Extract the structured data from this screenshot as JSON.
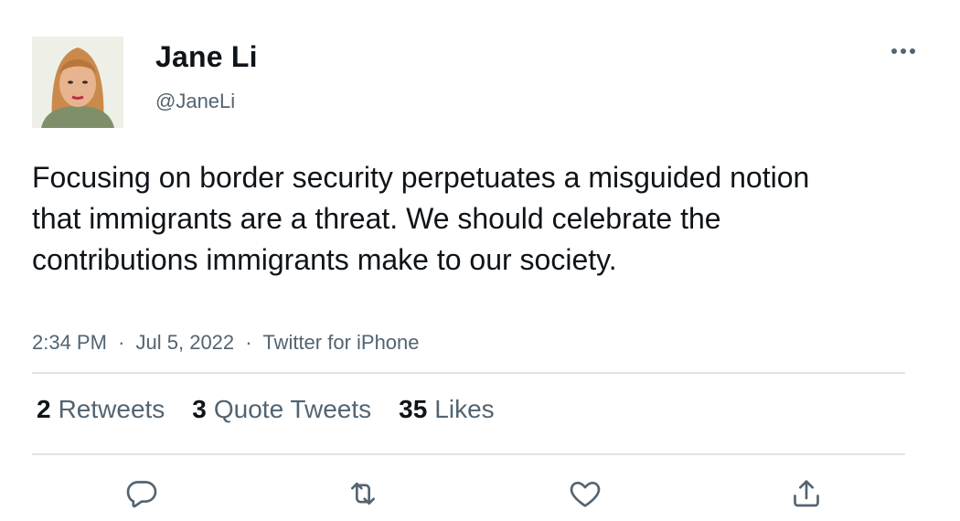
{
  "tweet": {
    "author_name": "Jane Li",
    "author_handle": "@JaneLi",
    "text": "Focusing on border security perpetuates a misguided notion that immigrants are a threat. We should celebrate the contributions immigrants make to our society.",
    "time": "2:34 PM",
    "date": "Jul 5, 2022",
    "source": "Twitter for iPhone",
    "separator": "·"
  },
  "stats": {
    "retweets_count": "2",
    "retweets_label": "Retweets",
    "quotes_count": "3",
    "quotes_label": "Quote Tweets",
    "likes_count": "35",
    "likes_label": "Likes"
  },
  "icons": {
    "more": "more-horizontal-icon",
    "reply": "reply-icon",
    "retweet": "retweet-icon",
    "like": "heart-icon",
    "share": "share-icon"
  },
  "colors": {
    "text_primary": "#0f1419",
    "text_secondary": "#536471",
    "divider": "#e1e4e6"
  }
}
